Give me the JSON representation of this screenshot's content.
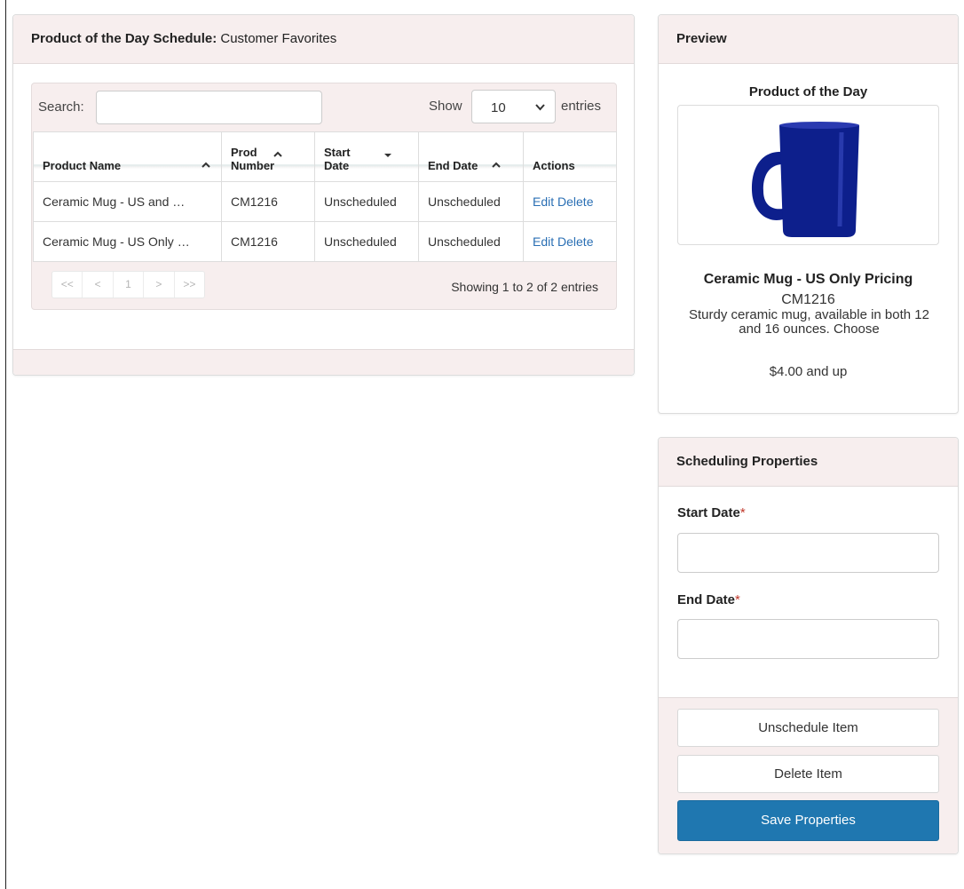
{
  "schedule_panel": {
    "title_bold": "Product of the Day Schedule:",
    "title_rest": " Customer Favorites",
    "search_label": "Search:",
    "search_value": "",
    "show_label": "Show",
    "show_value": "10",
    "entries_label": "entries",
    "columns": [
      "Product Name",
      "Prod Number",
      "Start Date",
      "End Date",
      "Actions"
    ],
    "column_lines": {
      "prod_number": [
        "Prod",
        "Number"
      ],
      "start_date": [
        "Start",
        "Date"
      ]
    },
    "rows": [
      {
        "name": "Ceramic Mug - US and …",
        "number": "CM1216",
        "start": "Unscheduled",
        "end": "Unscheduled",
        "edit": "Edit",
        "delete": "Delete"
      },
      {
        "name": "Ceramic Mug - US Only …",
        "number": "CM1216",
        "start": "Unscheduled",
        "end": "Unscheduled",
        "edit": "Edit",
        "delete": "Delete"
      }
    ],
    "pager": [
      "<<",
      "<",
      "1",
      ">",
      ">>"
    ],
    "showing_text": "Showing 1 to 2 of 2 entries"
  },
  "preview_panel": {
    "title": "Preview",
    "pod_title": "Product of the Day",
    "product_name": "Ceramic Mug - US Only Pricing",
    "product_number": "CM1216",
    "description": "Sturdy ceramic mug, available in both 12 and 16 ounces. Choose",
    "price": "$4.00 and up",
    "mug_color": "#0d1f8c"
  },
  "scheduling_panel": {
    "title": "Scheduling Properties",
    "start_label": "Start Date",
    "end_label": "End Date",
    "required_mark": "*",
    "start_value": "",
    "end_value": "",
    "unschedule_label": "Unschedule Item",
    "delete_label": "Delete Item",
    "save_label": "Save Properties",
    "primary_color": "#1f77b0"
  }
}
